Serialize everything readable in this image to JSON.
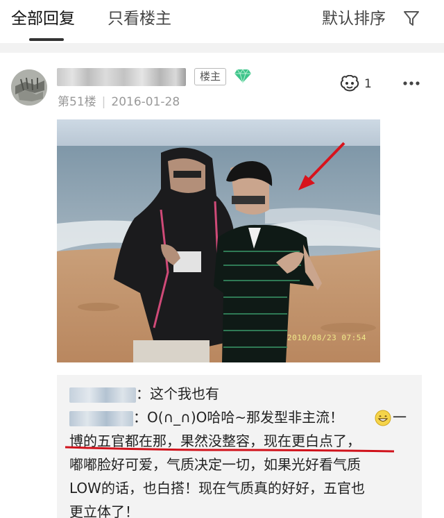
{
  "tabs": {
    "all": "全部回复",
    "owner_only": "只看楼主",
    "sort": "默认排序"
  },
  "post": {
    "owner_badge": "楼主",
    "floor": "第51楼",
    "date": "2016-01-28",
    "like_count": "1",
    "photo_timestamp": "2010/08/23 07:54"
  },
  "reply": {
    "line1_suffix": "：这个我也有",
    "line2_suffix": "：O(∩_∩)O哈哈~那发型非主流！",
    "line2_tail": "一",
    "line3": "博的五官都在那，果然没整容，现在更白点了，",
    "line4": "嘟嘟脸好可爱，气质决定一切，如果光好看气质",
    "line5": "LOW的话，也白搭！现在气质真的好好，五官也",
    "line6": "更立体了！"
  },
  "colors": {
    "highlight_red": "#d0121b",
    "arrow_red": "#d8131c",
    "gem_green": "#3ec48a"
  }
}
